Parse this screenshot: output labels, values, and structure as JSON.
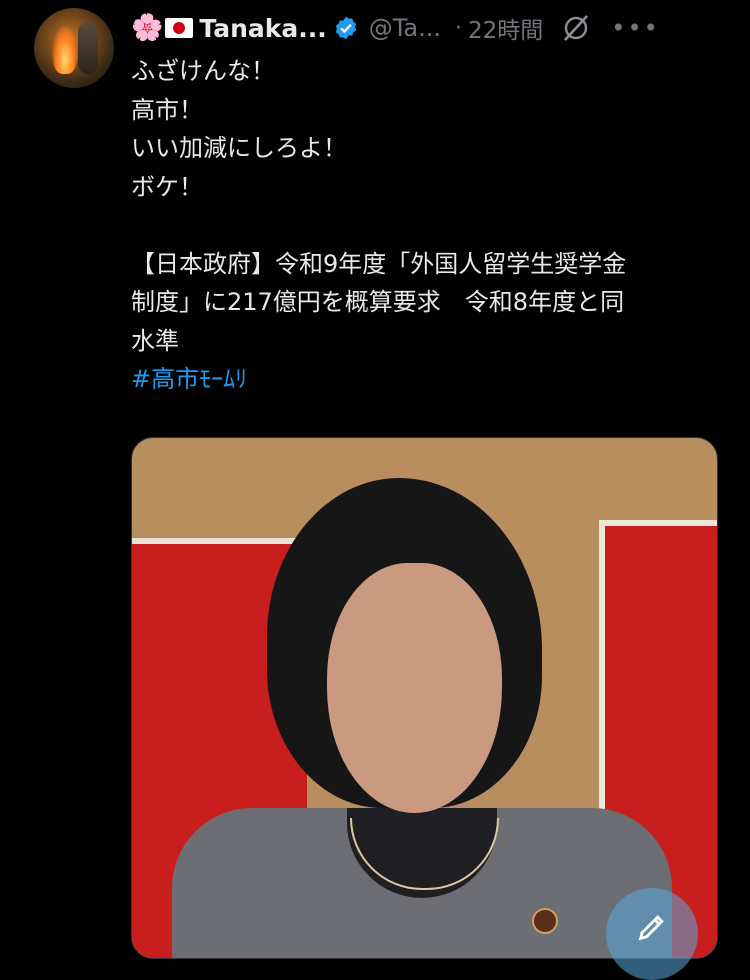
{
  "author": {
    "flag_emoji": "🌸",
    "name": "Tanaka...",
    "handle": "@Ta...",
    "separator": "·",
    "time": "22時間"
  },
  "icons": {
    "verified": "verified-badge-icon",
    "grok": "grok-icon",
    "more": "more-icon",
    "compose": "compose-icon"
  },
  "tweet": {
    "lines": [
      "ふざけんな！",
      "高市！",
      "いい加減にしろよ！",
      "ボケ！",
      "",
      "【日本政府】令和9年度「外国人留学生奨学金",
      "制度」に217億円を概算要求　令和8年度と同",
      "水準"
    ],
    "hashtag": "#高市ﾓｰﾑﾘ"
  },
  "colors": {
    "background": "#000000",
    "text": "#e7e9ea",
    "muted": "#71767b",
    "link": "#1d9bf0",
    "verified": "#1d9bf0"
  }
}
